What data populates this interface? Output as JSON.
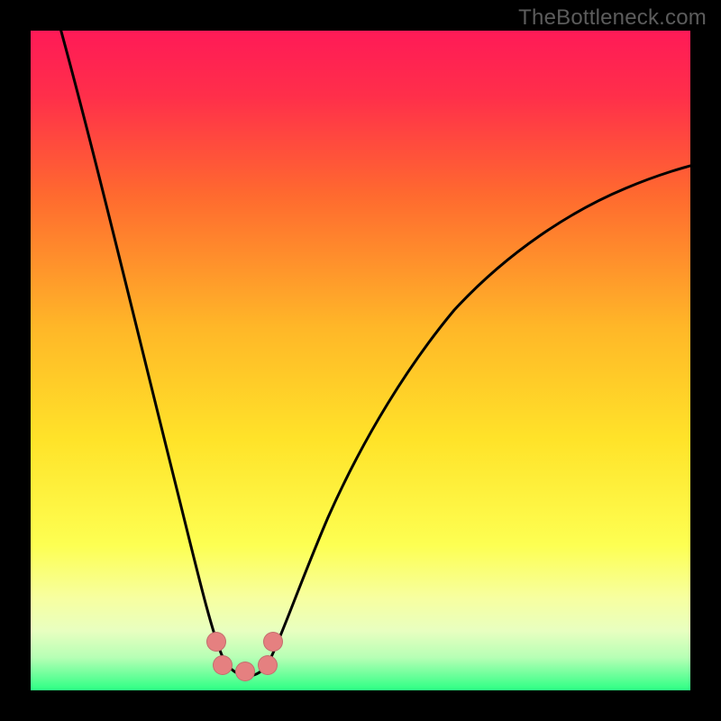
{
  "watermark": "TheBottleneck.com",
  "colors": {
    "frame": "#000000",
    "gradient_top": "#ff1a57",
    "gradient_mid_upper": "#ff8a2a",
    "gradient_mid": "#ffe329",
    "gradient_lower": "#fbff7a",
    "gradient_bottom_band": "#d7ffb0",
    "gradient_bottom": "#2cff84",
    "curve": "#000000",
    "marker": "#e58080"
  },
  "chart_data": {
    "type": "line",
    "title": "",
    "xlabel": "",
    "ylabel": "",
    "xlim": [
      0,
      100
    ],
    "ylim": [
      0,
      100
    ],
    "x": [
      0,
      3,
      6,
      9,
      12,
      15,
      18,
      21,
      24,
      26,
      28,
      30,
      32,
      34,
      36,
      38,
      42,
      48,
      55,
      63,
      72,
      82,
      92,
      100
    ],
    "series": [
      {
        "name": "bottleneck-curve",
        "values": [
          108,
          100,
          90,
          79,
          67,
          55,
          42,
          29,
          16,
          8,
          4,
          2,
          2,
          3,
          6,
          11,
          21,
          33,
          44,
          54,
          62,
          69,
          74,
          78
        ]
      }
    ],
    "markers": [
      {
        "x": 28,
        "y": 8
      },
      {
        "x": 29,
        "y": 4
      },
      {
        "x": 32.5,
        "y": 2
      },
      {
        "x": 36,
        "y": 4
      },
      {
        "x": 37,
        "y": 8
      }
    ],
    "notes": "V-shaped curve over vertical rainbow gradient; minimum near x≈32. Values are estimated from pixel positions as the chart has no visible axes or tick labels."
  }
}
